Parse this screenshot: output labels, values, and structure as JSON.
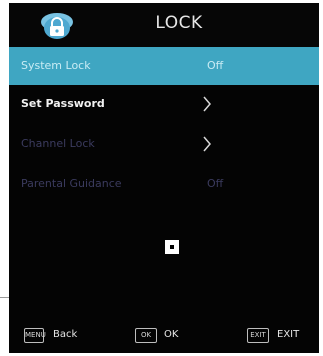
{
  "header": {
    "title": "LOCK",
    "icon": "lock-icon"
  },
  "menu": {
    "items": [
      {
        "label": "System Lock",
        "value": "Off",
        "state": "selected"
      },
      {
        "label": "Set Password",
        "value": "",
        "state": "normal",
        "icon": "chevron-right-icon"
      },
      {
        "label": "Channel Lock",
        "value": "",
        "state": "disabled",
        "icon": "chevron-right-icon"
      },
      {
        "label": "Parental Guidance",
        "value": "Off",
        "state": "disabled"
      }
    ]
  },
  "footer": {
    "back": {
      "key": "MENU",
      "label": "Back"
    },
    "ok": {
      "key": "OK",
      "label": "OK"
    },
    "exit": {
      "key": "EXIT",
      "label": "EXIT"
    }
  },
  "colors": {
    "highlight": "#3fa6c2",
    "background": "#040404",
    "disabled_text": "#3b3b5e"
  }
}
